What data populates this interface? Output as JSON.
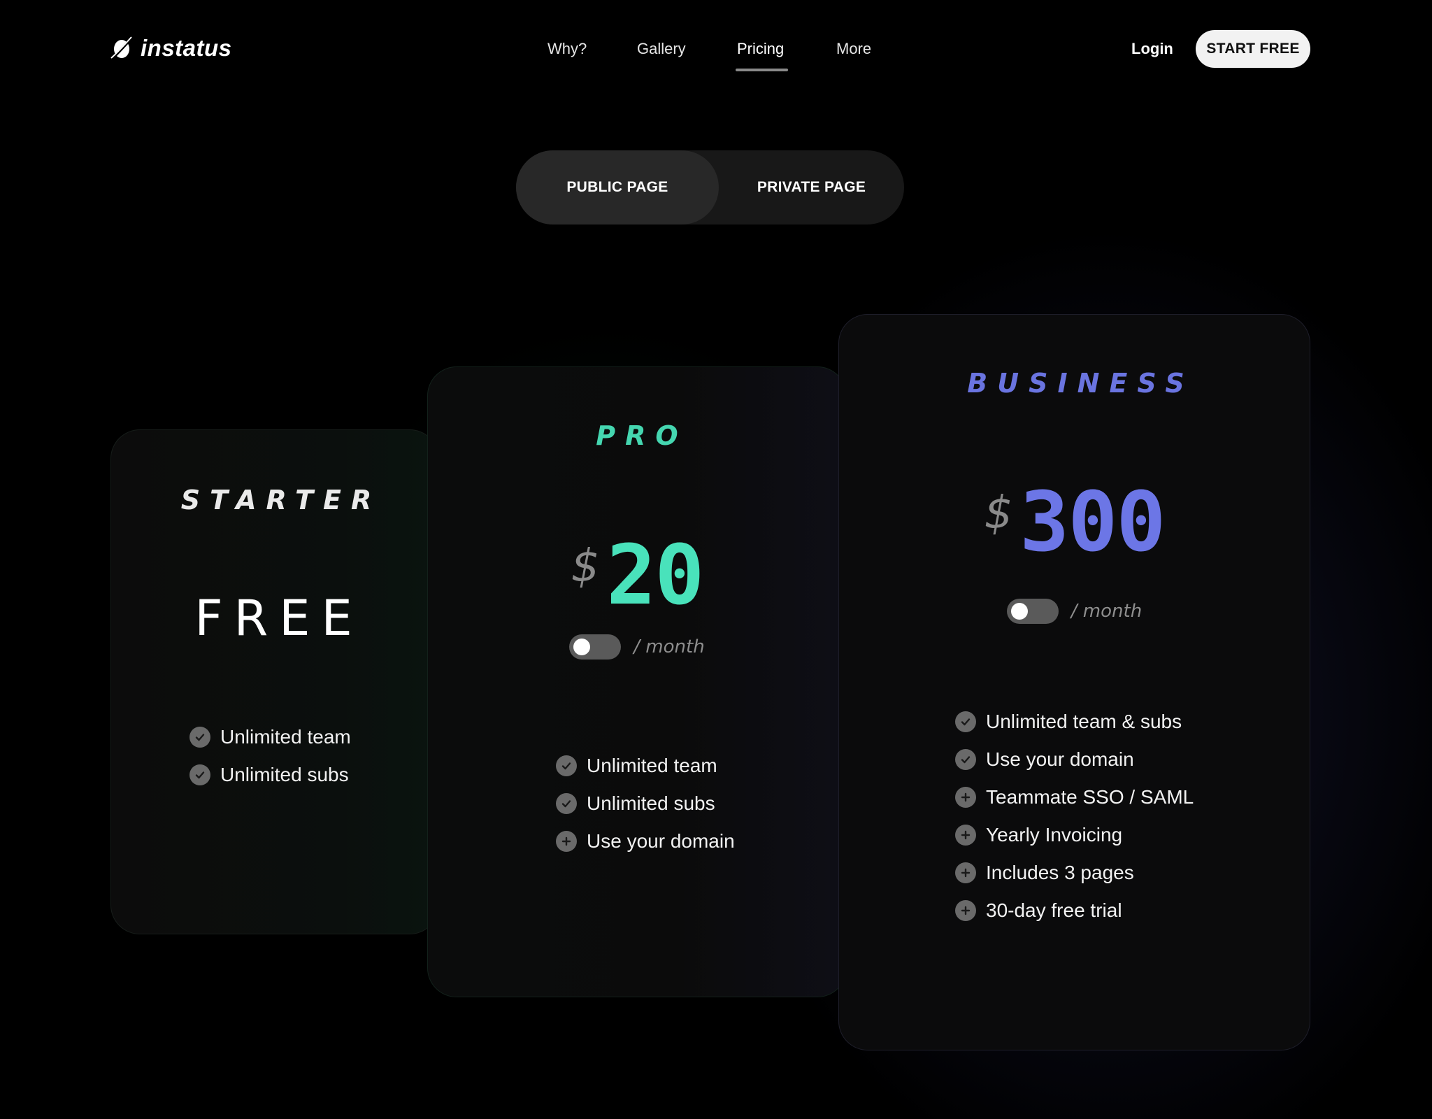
{
  "brand": {
    "name": "instatus"
  },
  "nav": {
    "items": [
      "Why?",
      "Gallery",
      "Pricing",
      "More"
    ],
    "active": "Pricing"
  },
  "header": {
    "login_label": "Login",
    "cta_label": "START FREE"
  },
  "page_switch": {
    "options": [
      "PUBLIC PAGE",
      "PRIVATE PAGE"
    ],
    "selected": "PUBLIC PAGE"
  },
  "plans": [
    {
      "tier": "STARTER",
      "price": "FREE",
      "accent": "#ffffff",
      "features": [
        {
          "text": "Unlimited team",
          "icon": "check-icon"
        },
        {
          "text": "Unlimited subs",
          "icon": "check-icon"
        }
      ]
    },
    {
      "tier": "PRO",
      "currency": "$",
      "price": "20",
      "period": "/ month",
      "billing_toggle_on": false,
      "accent": "#49e2bb",
      "features": [
        {
          "text": "Unlimited team",
          "icon": "check-icon"
        },
        {
          "text": "Unlimited subs",
          "icon": "check-icon"
        },
        {
          "text": "Use your domain",
          "icon": "plus-icon"
        }
      ]
    },
    {
      "tier": "BUSINESS",
      "currency": "$",
      "price": "300",
      "period": "/ month",
      "billing_toggle_on": false,
      "accent": "#6c76e6",
      "features": [
        {
          "text": "Unlimited team & subs",
          "icon": "check-icon"
        },
        {
          "text": "Use your domain",
          "icon": "check-icon"
        },
        {
          "text": "Teammate SSO / SAML",
          "icon": "plus-icon"
        },
        {
          "text": "Yearly Invoicing",
          "icon": "plus-icon"
        },
        {
          "text": "Includes 3 pages",
          "icon": "plus-icon"
        },
        {
          "text": "30-day free trial",
          "icon": "plus-icon"
        }
      ]
    }
  ]
}
